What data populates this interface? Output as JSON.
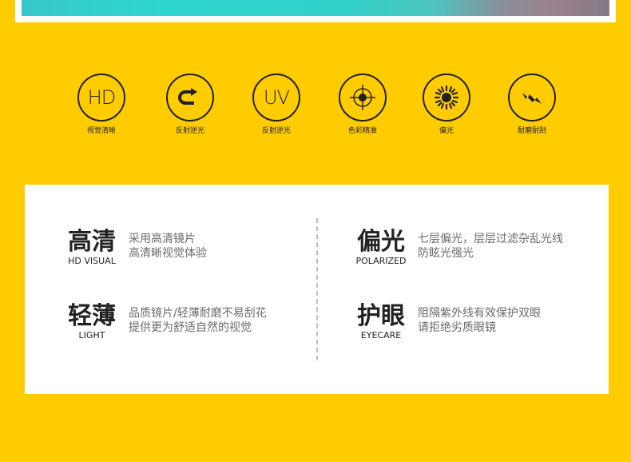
{
  "colors": {
    "background": "#FFCC00",
    "panel": "#ffffff",
    "text": "#222222",
    "desc": "#6b6b6b"
  },
  "icons": [
    {
      "icon": "hd-icon",
      "glyph": "HD",
      "label": "视觉清晰"
    },
    {
      "icon": "reflect-arrow-icon",
      "glyph": "",
      "label": "反射逆光"
    },
    {
      "icon": "uv-icon",
      "glyph": "UV",
      "label": "反射逆光"
    },
    {
      "icon": "crosshair-icon",
      "glyph": "",
      "label": "色彩精准"
    },
    {
      "icon": "sun-icon",
      "glyph": "",
      "label": "偏光"
    },
    {
      "icon": "lightning-icon",
      "glyph": "",
      "label": "耐磨耐刮"
    }
  ],
  "features": {
    "hd": {
      "title": "高清",
      "en": "HD VISUAL",
      "line1": "采用高清镜片",
      "line2": "高清晰视觉体验"
    },
    "light": {
      "title": "轻薄",
      "en": "LIGHT",
      "line1": "品质镜片/轻薄耐磨不易刮花",
      "line2": "提供更为舒适自然的视觉"
    },
    "polarized": {
      "title": "偏光",
      "en": "POLARIZED",
      "line1": "七层偏光，层层过滤杂乱光线",
      "line2": "防眩光强光"
    },
    "eyecare": {
      "title": "护眼",
      "en": "EYECARE",
      "line1": "阻隔紫外线有效保护双眼",
      "line2": "请拒绝劣质眼镜"
    }
  }
}
